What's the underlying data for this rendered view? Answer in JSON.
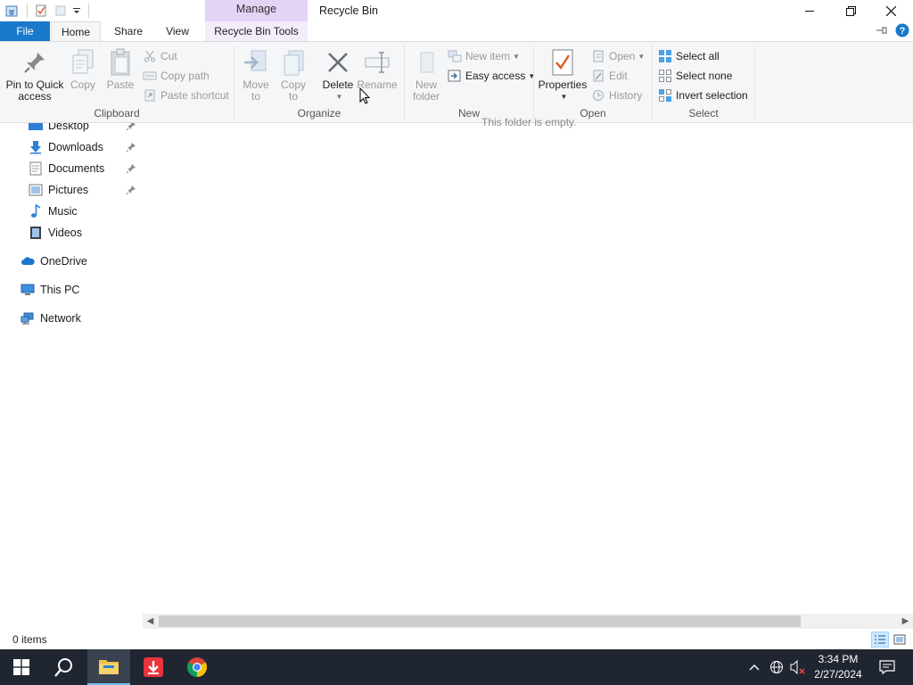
{
  "window": {
    "title": "Recycle Bin",
    "contextual_tab_group": "Manage",
    "accent_color": "#1979ca",
    "manage_color": "#e3d3f5"
  },
  "tabs": {
    "file": "File",
    "home": "Home",
    "share": "Share",
    "view": "View",
    "recycle_bin_tools": "Recycle Bin Tools"
  },
  "ribbon": {
    "clipboard": {
      "label": "Clipboard",
      "pin": "Pin to Quick access",
      "copy": "Copy",
      "paste": "Paste",
      "cut": "Cut",
      "copy_path": "Copy path",
      "paste_shortcut": "Paste shortcut"
    },
    "organize": {
      "label": "Organize",
      "move_to": "Move to",
      "copy_to": "Copy to",
      "delete": "Delete",
      "rename": "Rename"
    },
    "new": {
      "label": "New",
      "new_folder": "New folder",
      "new_item": "New item",
      "easy_access": "Easy access"
    },
    "open": {
      "label": "Open",
      "properties": "Properties",
      "open": "Open",
      "edit": "Edit",
      "history": "History"
    },
    "select": {
      "label": "Select",
      "select_all": "Select all",
      "select_none": "Select none",
      "invert_selection": "Invert selection"
    }
  },
  "nav": {
    "items": [
      {
        "label": "Desktop",
        "icon": "desktop-icon",
        "pinned": true
      },
      {
        "label": "Downloads",
        "icon": "downloads-icon",
        "pinned": true
      },
      {
        "label": "Documents",
        "icon": "documents-icon",
        "pinned": true
      },
      {
        "label": "Pictures",
        "icon": "pictures-icon",
        "pinned": true
      },
      {
        "label": "Music",
        "icon": "music-icon",
        "pinned": false
      },
      {
        "label": "Videos",
        "icon": "videos-icon",
        "pinned": false
      }
    ],
    "onedrive": "OneDrive",
    "this_pc": "This PC",
    "network": "Network"
  },
  "content": {
    "empty_message": "This folder is empty."
  },
  "status": {
    "item_count": "0 items"
  },
  "taskbar": {
    "time": "3:34 PM",
    "date": "2/27/2024"
  }
}
